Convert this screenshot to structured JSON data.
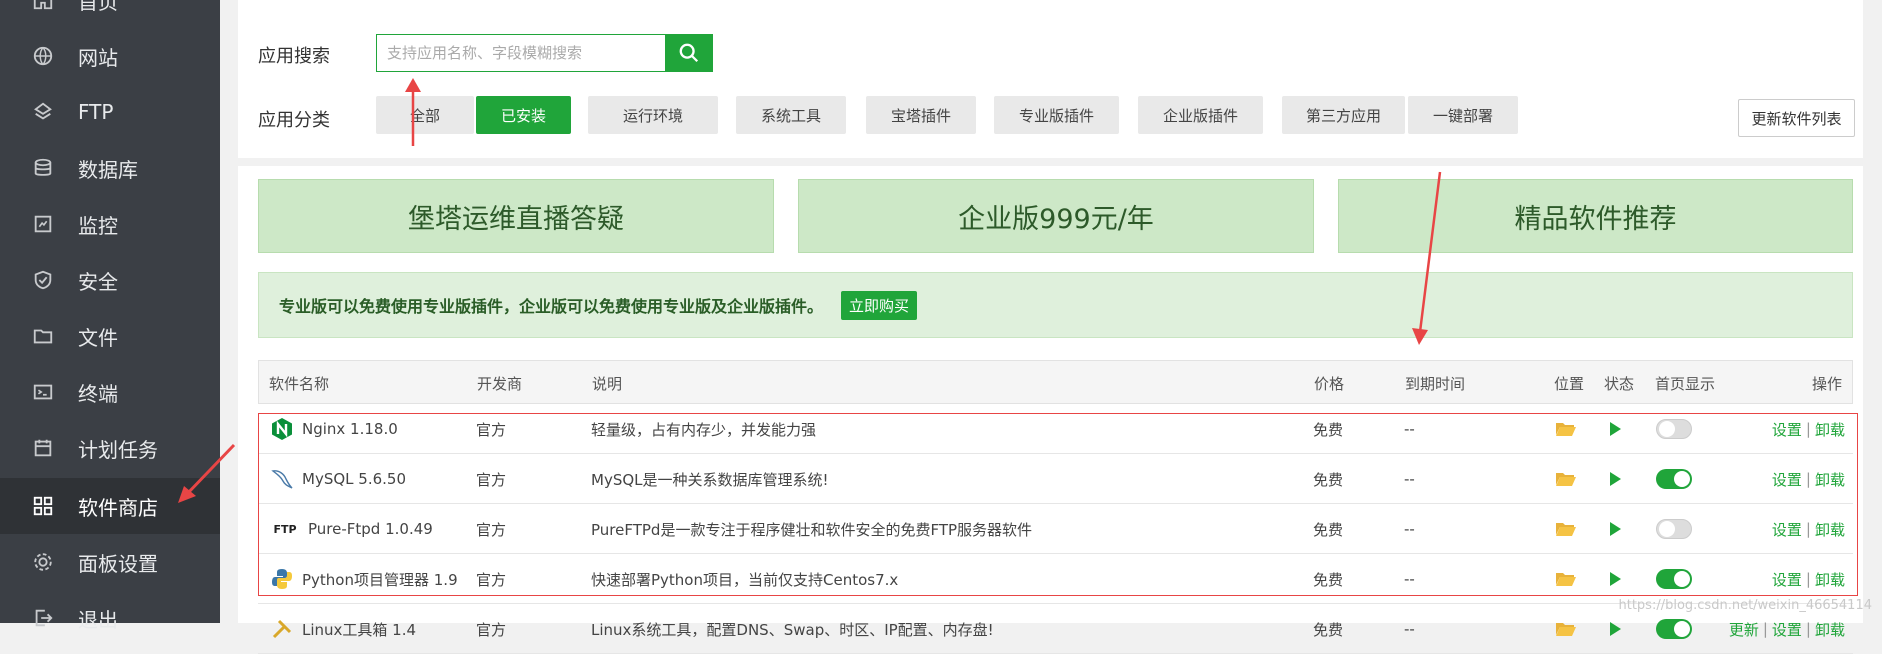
{
  "sidebar": {
    "items": [
      {
        "label": "首页",
        "icon": "home-icon"
      },
      {
        "label": "网站",
        "icon": "globe-icon"
      },
      {
        "label": "FTP",
        "icon": "ftp-icon"
      },
      {
        "label": "数据库",
        "icon": "database-icon"
      },
      {
        "label": "监控",
        "icon": "monitor-icon"
      },
      {
        "label": "安全",
        "icon": "shield-icon"
      },
      {
        "label": "文件",
        "icon": "folder-icon"
      },
      {
        "label": "终端",
        "icon": "terminal-icon"
      },
      {
        "label": "计划任务",
        "icon": "calendar-icon"
      },
      {
        "label": "软件商店",
        "icon": "grid-icon",
        "active": true
      },
      {
        "label": "面板设置",
        "icon": "gear-icon"
      },
      {
        "label": "退出",
        "icon": "logout-icon"
      }
    ]
  },
  "search": {
    "label": "应用搜索",
    "placeholder": "支持应用名称、字段模糊搜索",
    "button_icon": "search-icon"
  },
  "categories": {
    "label": "应用分类",
    "items": [
      {
        "label": "全部"
      },
      {
        "label": "已安装",
        "active": true
      },
      {
        "label": "运行环境"
      },
      {
        "label": "系统工具"
      },
      {
        "label": "宝塔插件"
      },
      {
        "label": "专业版插件"
      },
      {
        "label": "企业版插件"
      },
      {
        "label": "第三方应用"
      },
      {
        "label": "一键部署"
      }
    ],
    "update_label": "更新软件列表"
  },
  "banners": [
    {
      "label": "堡塔运维直播答疑"
    },
    {
      "label": "企业版999元/年"
    },
    {
      "label": "精品软件推荐"
    }
  ],
  "notice": {
    "text": "专业版可以免费使用专业版插件，企业版可以免费使用专业版及企业版插件。",
    "button": "立即购买"
  },
  "table": {
    "headers": {
      "name": "软件名称",
      "dev": "开发商",
      "desc": "说明",
      "price": "价格",
      "expire": "到期时间",
      "location": "位置",
      "status": "状态",
      "home": "首页显示",
      "ops": "操作"
    },
    "rows": [
      {
        "name": "Nginx 1.18.0",
        "icon": "nginx-icon",
        "dev": "官方",
        "desc": "轻量级，占有内存少，并发能力强",
        "price": "免费",
        "expire": "--",
        "home_on": false,
        "ops": [
          "设置",
          "卸载"
        ]
      },
      {
        "name": "MySQL 5.6.50",
        "icon": "mysql-icon",
        "dev": "官方",
        "desc": "MySQL是一种关系数据库管理系统!",
        "price": "免费",
        "expire": "--",
        "home_on": true,
        "ops": [
          "设置",
          "卸载"
        ]
      },
      {
        "name": "Pure-Ftpd 1.0.49",
        "icon": "ftp-logo-icon",
        "icon_text": "FTP",
        "dev": "官方",
        "desc": "PureFTPd是一款专注于程序健壮和软件安全的免费FTP服务器软件",
        "price": "免费",
        "expire": "--",
        "home_on": false,
        "ops": [
          "设置",
          "卸载"
        ]
      },
      {
        "name": "Python项目管理器 1.9",
        "icon": "python-icon",
        "dev": "官方",
        "desc": "快速部署Python项目，当前仅支持Centos7.x",
        "price": "免费",
        "expire": "--",
        "home_on": true,
        "ops": [
          "设置",
          "卸载"
        ]
      },
      {
        "name": "Linux工具箱 1.4",
        "icon": "tools-icon",
        "dev": "官方",
        "desc": "Linux系统工具，配置DNS、Swap、时区、IP配置、内存盘!",
        "price": "免费",
        "expire": "--",
        "home_on": true,
        "ops": [
          "更新",
          "设置",
          "卸载"
        ]
      }
    ]
  },
  "watermark": "https://blog.csdn.net/weixin_46654114",
  "colors": {
    "accent": "#20a53a",
    "sidebar": "#3b3f45",
    "annotation": "#e84545"
  }
}
